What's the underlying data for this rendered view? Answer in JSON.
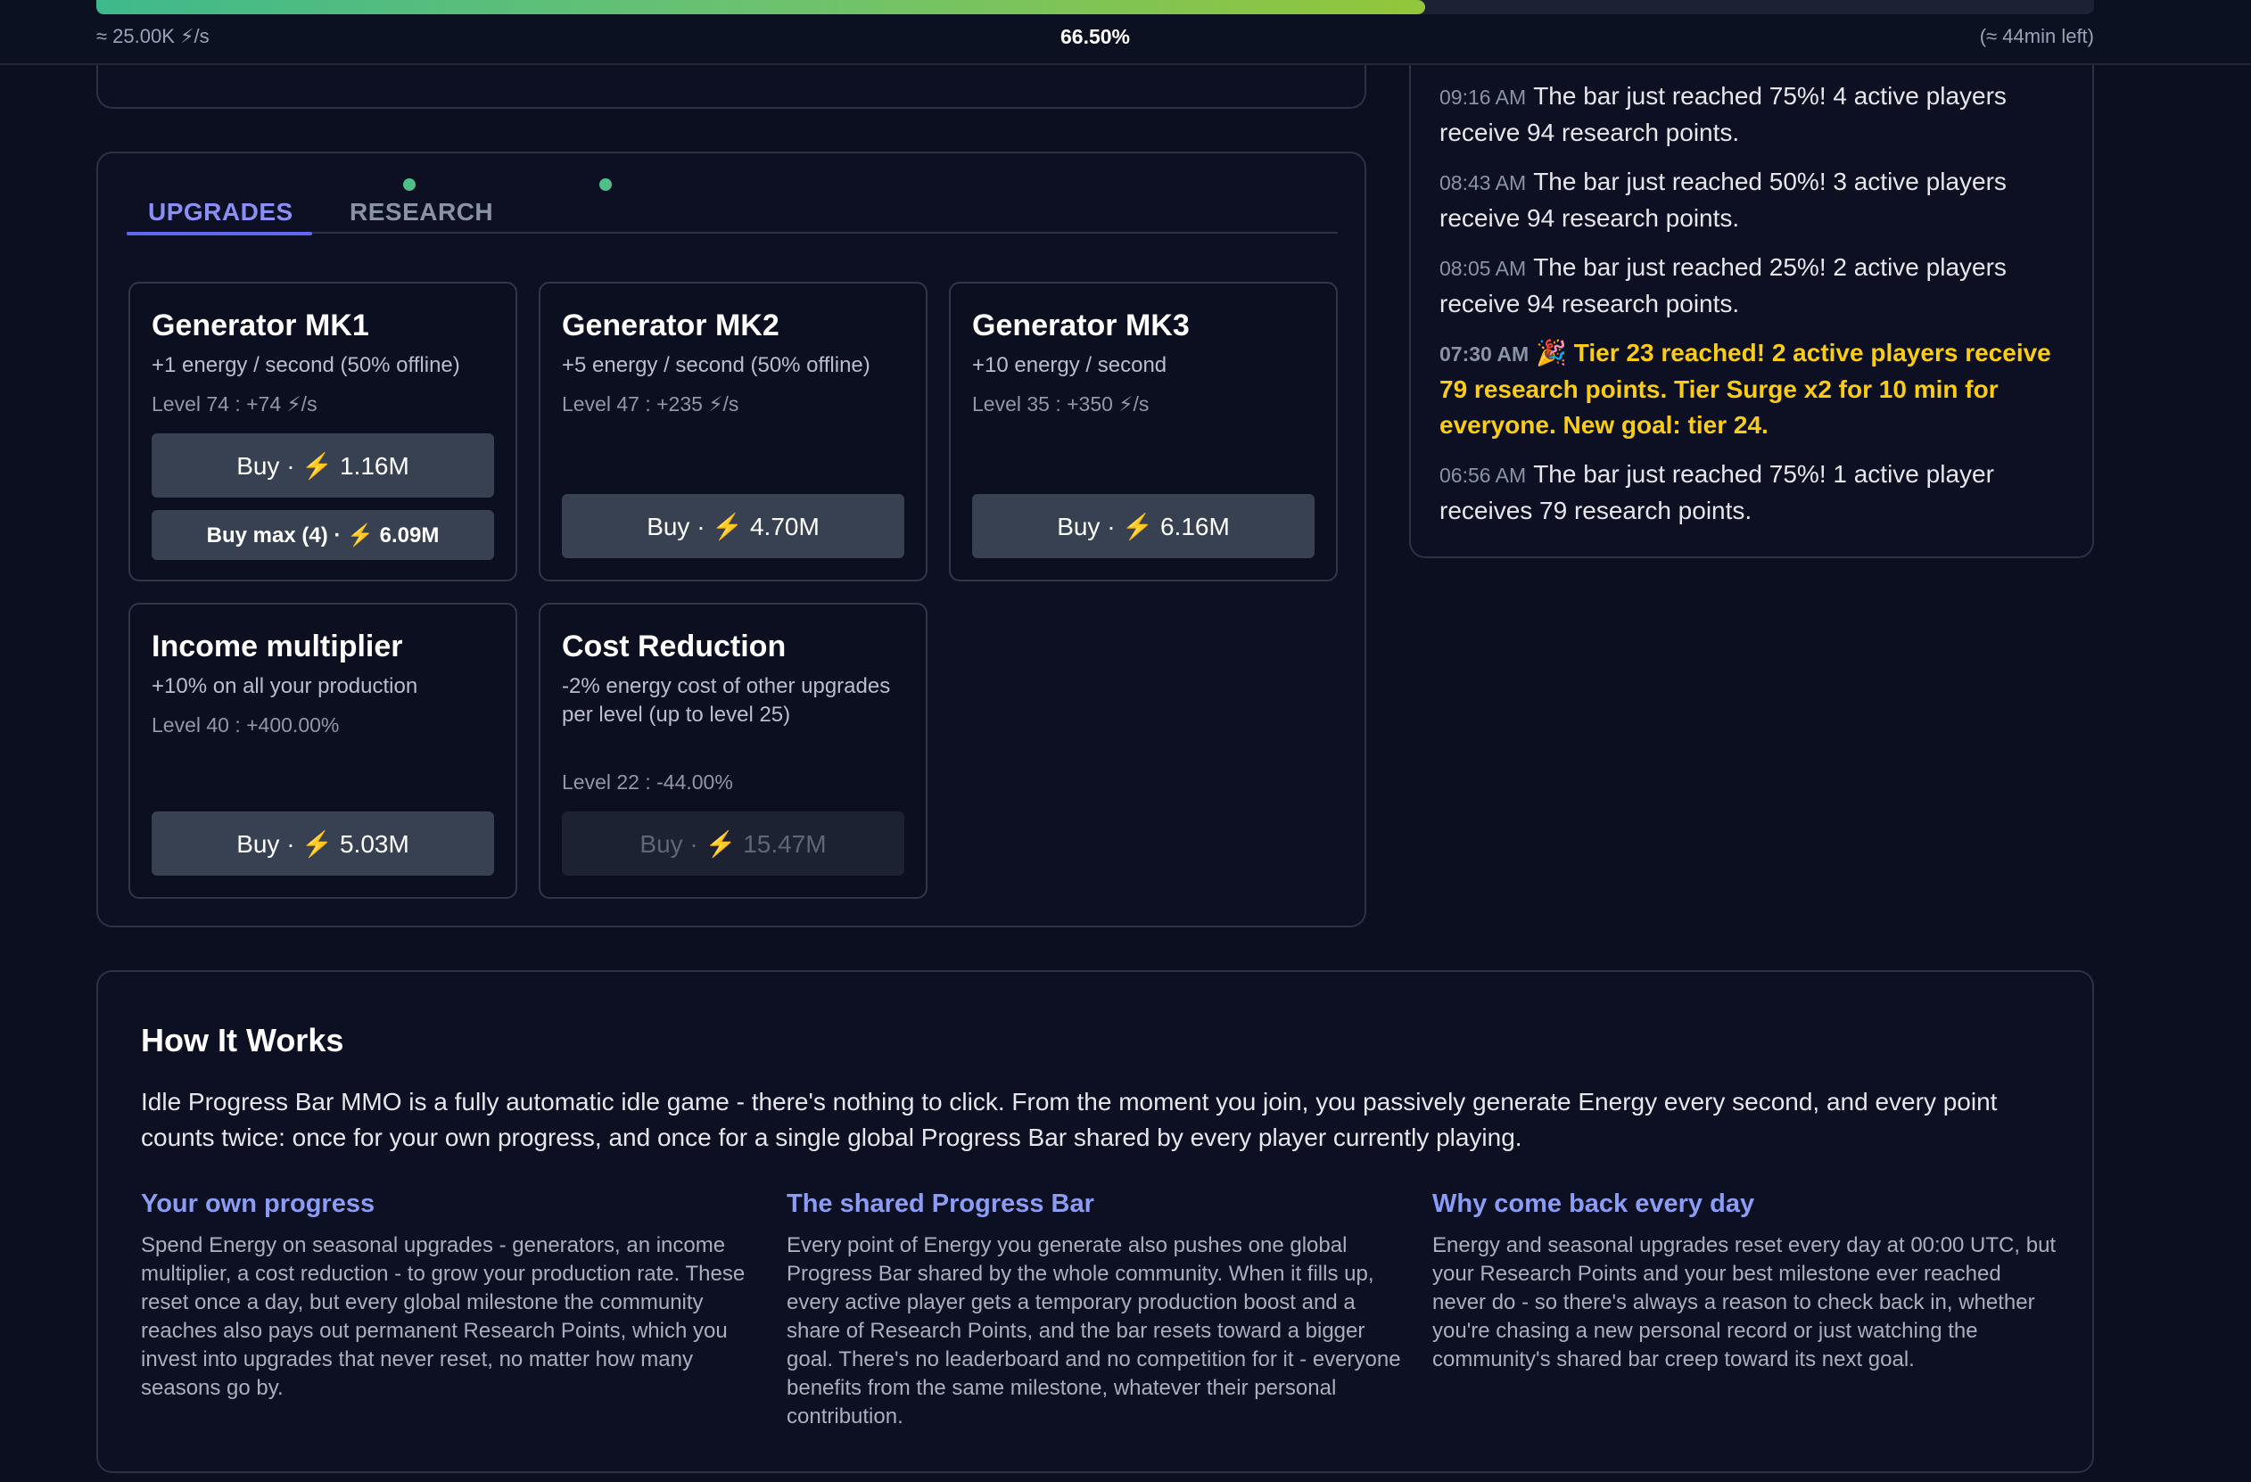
{
  "progress": {
    "rate": "≈ 25.00K ⚡/s",
    "percent_label": "66.50%",
    "percent_value": 0.665,
    "time_left": "(≈ 44min left)",
    "gradient_start": "#3fb98b",
    "gradient_end": "#93c63a"
  },
  "tabs": {
    "upgrades_label": "UPGRADES",
    "research_label": "RESEARCH",
    "active": "upgrades",
    "indicator_color": "#4fbf8a"
  },
  "upgrades": [
    {
      "title": "Generator MK1",
      "desc": "+1 energy / second (50% offline)",
      "level": "Level 74 : +74 ⚡/s",
      "buy_prefix": "Buy · ",
      "buy_cost": "1.16M",
      "buy_max_prefix": "Buy max (4) · ",
      "buy_max_cost": "6.09M"
    },
    {
      "title": "Generator MK2",
      "desc": "+5 energy / second (50% offline)",
      "level": "Level 47 : +235 ⚡/s",
      "buy_prefix": "Buy · ",
      "buy_cost": "4.70M"
    },
    {
      "title": "Generator MK3",
      "desc": "+10 energy / second",
      "level": "Level 35 : +350 ⚡/s",
      "buy_prefix": "Buy · ",
      "buy_cost": "6.16M"
    },
    {
      "title": "Income multiplier",
      "desc": "+10% on all your production",
      "level": "Level 40 : +400.00%",
      "buy_prefix": "Buy · ",
      "buy_cost": "5.03M"
    },
    {
      "title": "Cost Reduction",
      "desc": "-2% energy cost of other upgrades per level (up to level 25)",
      "level": "Level 22 : -44.00%",
      "buy_prefix": "Buy · ",
      "buy_cost": "15.47M",
      "disabled": true
    }
  ],
  "bolt_icon": "⚡",
  "log": [
    {
      "time": "09:16 AM",
      "text": "The bar just reached 75%! 4 active players receive 94 research points."
    },
    {
      "time": "08:43 AM",
      "text": "The bar just reached 50%! 3 active players receive 94 research points."
    },
    {
      "time": "08:05 AM",
      "text": "The bar just reached 25%! 2 active players receive 94 research points."
    },
    {
      "time": "07:30 AM",
      "text": "🎉 Tier 23 reached! 2 active players receive 79 research points. Tier Surge x2 for 10 min for everyone. New goal: tier 24.",
      "milestone": true
    },
    {
      "time": "06:56 AM",
      "text": "The bar just reached 75%! 1 active player receives 79 research points."
    }
  ],
  "how_it_works": {
    "title": "How It Works",
    "intro": "Idle Progress Bar MMO is a fully automatic idle game - there's nothing to click. From the moment you join, you passively generate Energy every second, and every point counts twice: once for your own progress, and once for a single global Progress Bar shared by every player currently playing.",
    "columns": [
      {
        "heading": "Your own progress",
        "body": "Spend Energy on seasonal upgrades - generators, an income multiplier, a cost reduction - to grow your production rate. These reset once a day, but every global milestone the community reaches also pays out permanent Research Points, which you invest into upgrades that never reset, no matter how many seasons go by."
      },
      {
        "heading": "The shared Progress Bar",
        "body": "Every point of Energy you generate also pushes one global Progress Bar shared by the whole community. When it fills up, every active player gets a temporary production boost and a share of Research Points, and the bar resets toward a bigger goal. There's no leaderboard and no competition for it - everyone benefits from the same milestone, whatever their personal contribution."
      },
      {
        "heading": "Why come back every day",
        "body": "Energy and seasonal upgrades reset every day at 00:00 UTC, but your Research Points and your best milestone ever reached never do - so there's always a reason to check back in, whether you're chasing a new personal record or just watching the community's shared bar creep toward its next goal."
      }
    ]
  },
  "colors": {
    "accent": "#6366f1",
    "milestone": "#facc15",
    "heading_blue": "#8b9cf5",
    "button_bg": "#374151"
  }
}
